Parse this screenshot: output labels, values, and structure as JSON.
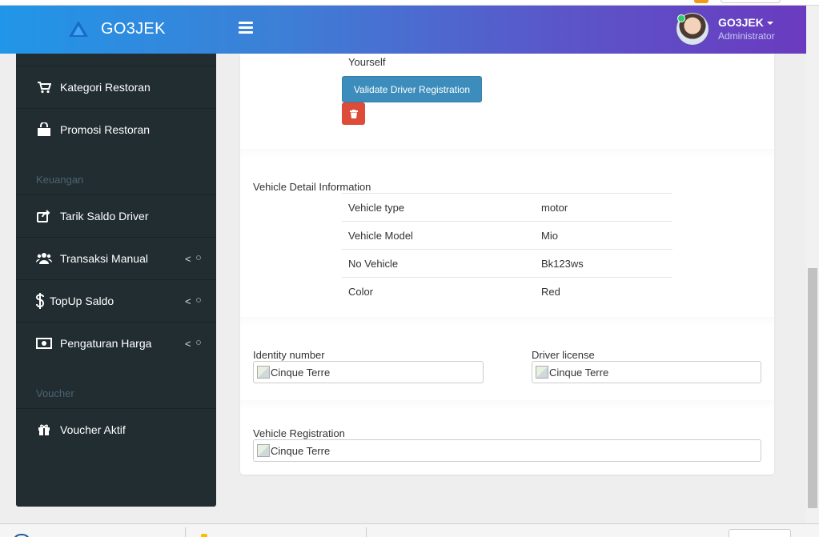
{
  "app": {
    "title": "GO3JEK",
    "brand_color": "#2196e8",
    "accent_color": "#6a3bbf"
  },
  "header": {
    "menu_icon": "hamburger-icon",
    "user": {
      "name": "GO3JEK",
      "role": "Administrator",
      "status_color": "#2ecc71"
    }
  },
  "sidebar": {
    "items_top": [
      {
        "label": "Kategori Restoran",
        "icon": "cart-icon"
      },
      {
        "label": "Promosi Restoran",
        "icon": "shopping-bag-icon"
      }
    ],
    "section_keuangan": "Keuangan",
    "items_keuangan": [
      {
        "label": "Tarik Saldo Driver",
        "icon": "share-square-icon"
      },
      {
        "label": "Transaksi Manual",
        "icon": "users-icon",
        "arrow": "<"
      },
      {
        "label": "TopUp Saldo",
        "icon": "dollar-icon",
        "arrow": "<"
      },
      {
        "label": "Pengaturan Harga",
        "icon": "money-bill-icon",
        "arrow": "<"
      }
    ],
    "section_voucher": "Voucher",
    "items_voucher": [
      {
        "label": "Voucher Aktif",
        "icon": "gift-icon"
      }
    ]
  },
  "main": {
    "yourself_text": "Yourself",
    "validate_button": "Validate Driver Registration",
    "delete_icon": "trash-icon",
    "vehicle_section_title": "Vehicle Detail Information",
    "vehicle_rows": [
      {
        "label": "Vehicle type",
        "value": "motor"
      },
      {
        "label": "Vehicle Model",
        "value": "Mio"
      },
      {
        "label": "No Vehicle",
        "value": "Bk123ws"
      },
      {
        "label": "Color",
        "value": "Red"
      }
    ],
    "identity_label": "Identity number",
    "identity_img_alt": "Cinque Terre",
    "license_label": "Driver license",
    "license_img_alt": "Cinque Terre",
    "registration_label": "Vehicle Registration",
    "registration_img_alt": "Cinque Terre"
  }
}
